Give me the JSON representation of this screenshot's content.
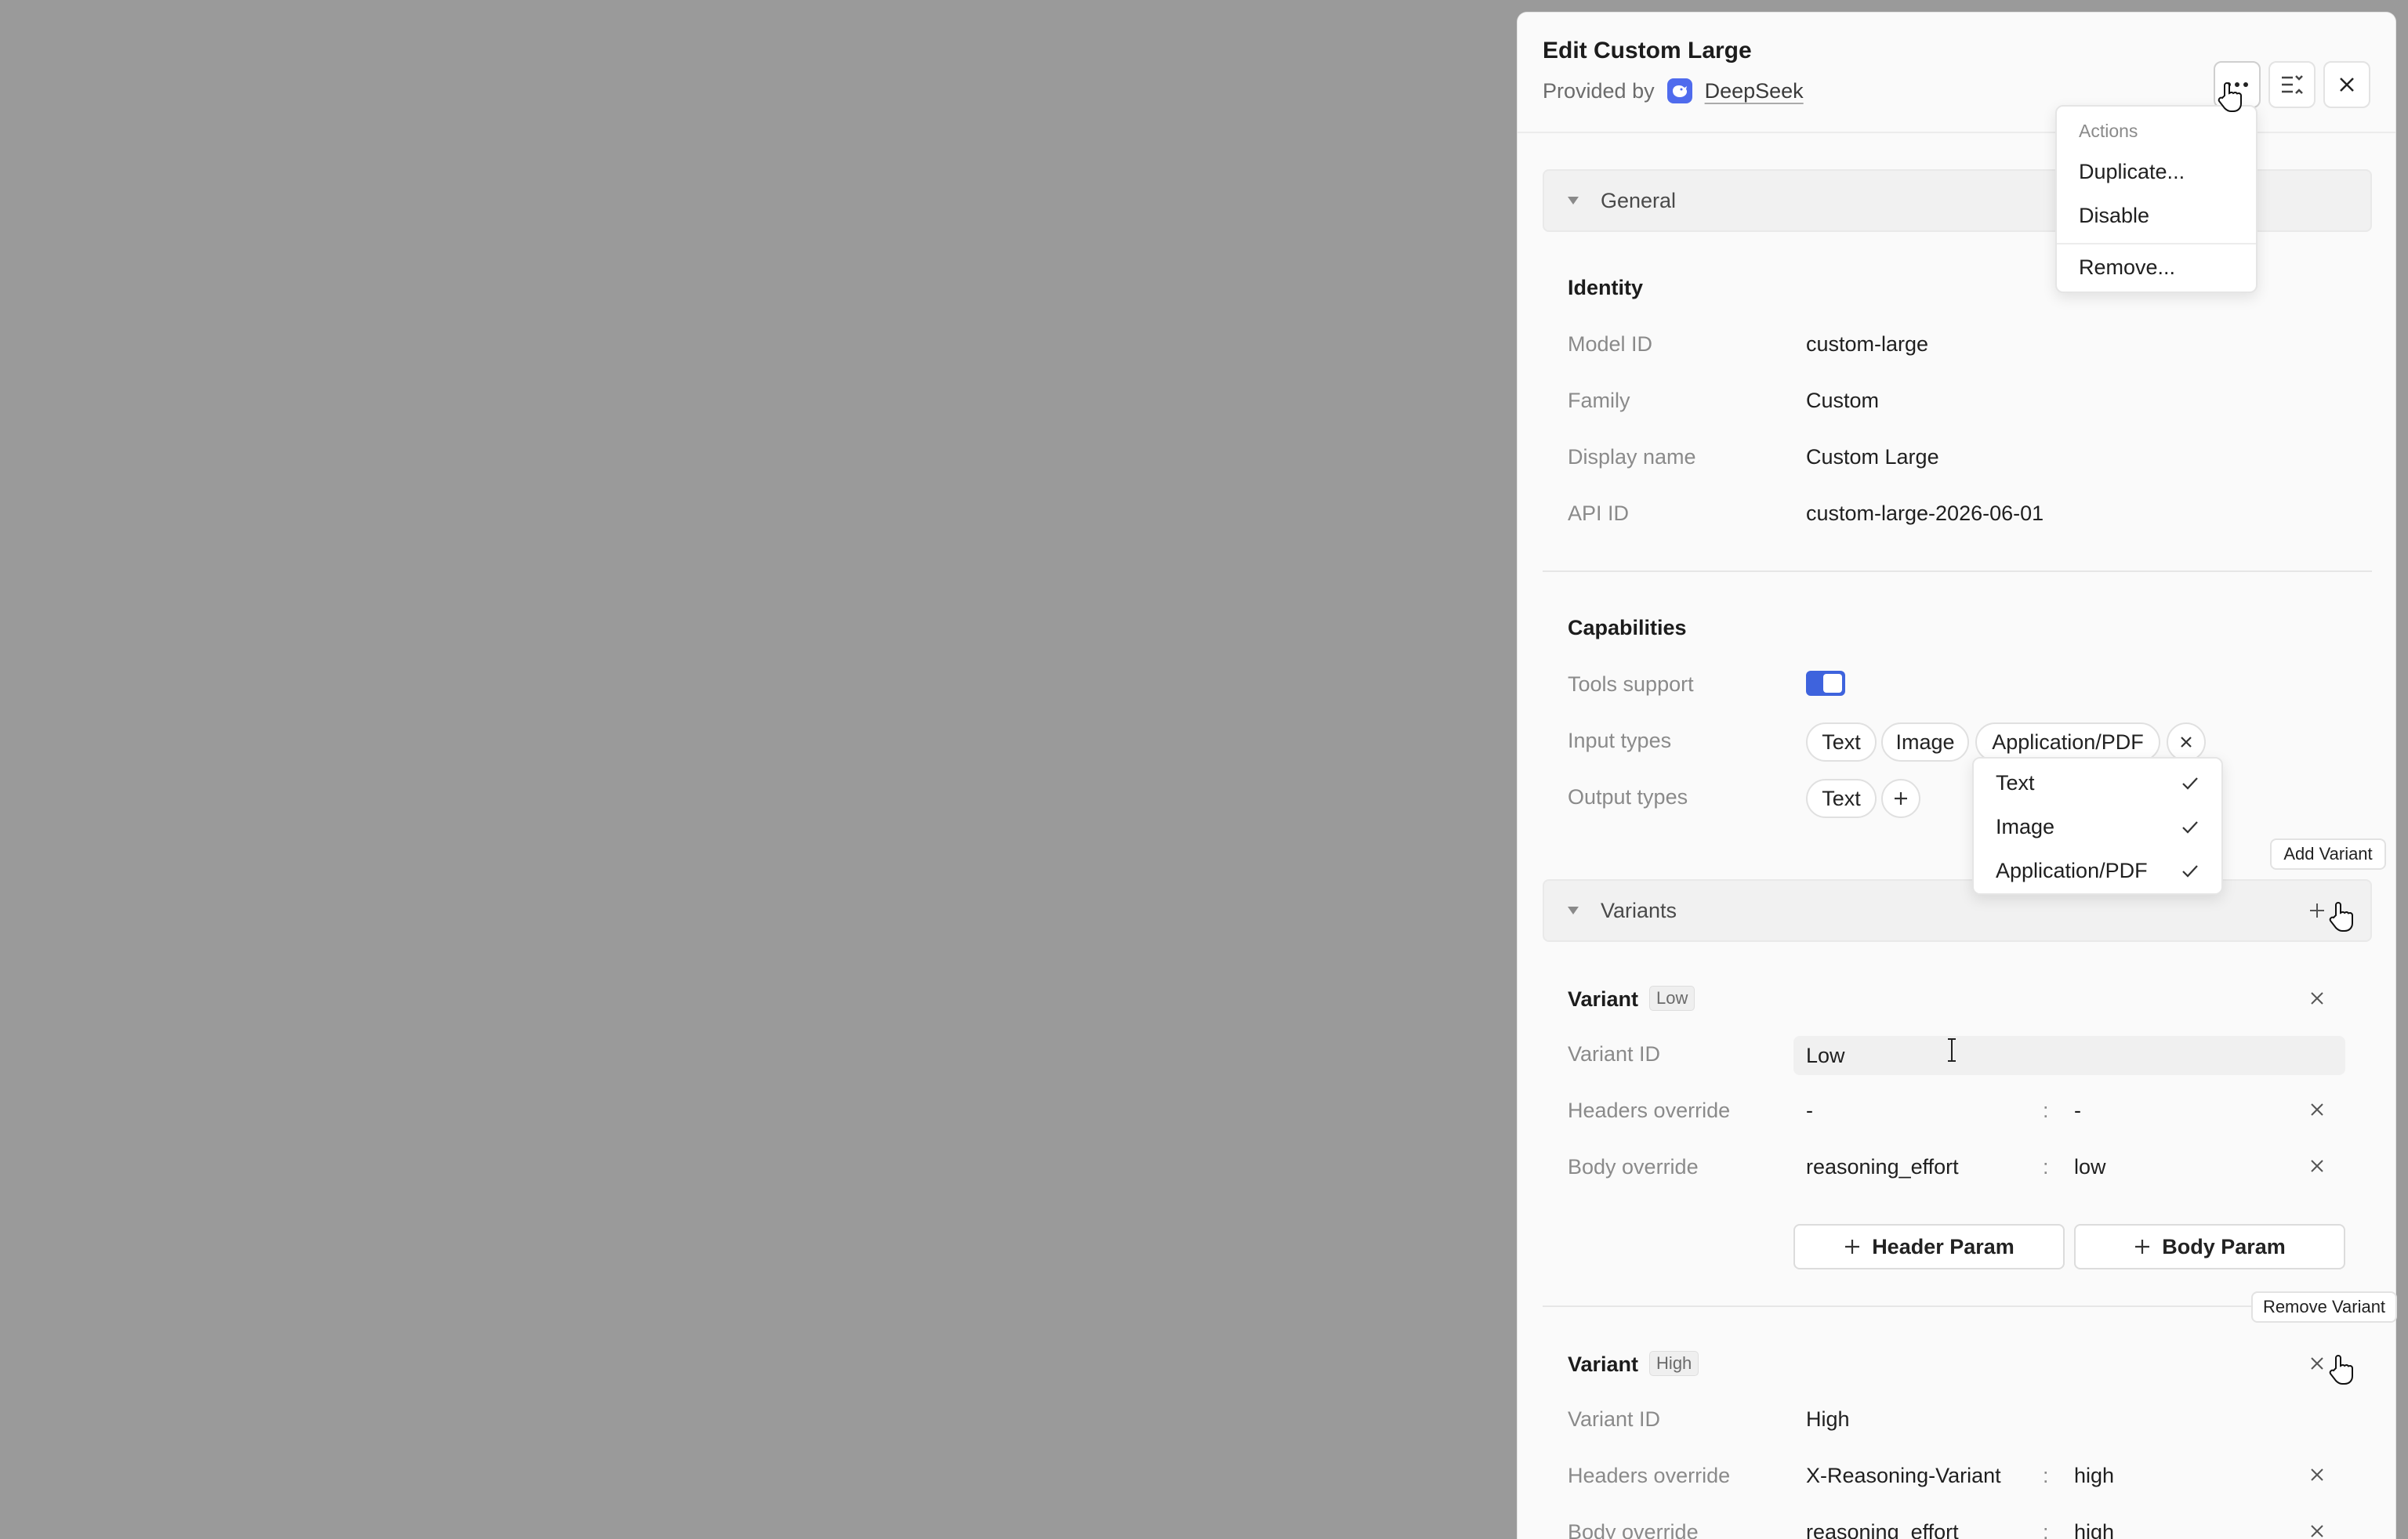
{
  "header": {
    "title": "Edit Custom Large",
    "provided_by_label": "Provided by",
    "provider_name": "DeepSeek"
  },
  "actions_menu": {
    "header": "Actions",
    "items": [
      "Duplicate...",
      "Disable",
      "Remove..."
    ]
  },
  "general": {
    "section_label": "General",
    "identity_title": "Identity",
    "fields": [
      {
        "label": "Model ID",
        "value": "custom-large"
      },
      {
        "label": "Family",
        "value": "Custom"
      },
      {
        "label": "Display name",
        "value": "Custom Large"
      },
      {
        "label": "API ID",
        "value": "custom-large-2026-06-01"
      }
    ],
    "capabilities_title": "Capabilities",
    "tools_support_label": "Tools support",
    "tools_support_on": true,
    "input_types_label": "Input types",
    "input_types": [
      "Text",
      "Image",
      "Application/PDF"
    ],
    "output_types_label": "Output types",
    "output_types": [
      "Text"
    ]
  },
  "input_type_dropdown": {
    "options": [
      "Text",
      "Image",
      "Application/PDF"
    ]
  },
  "variants": {
    "section_label": "Variants",
    "add_tooltip": "Add Variant",
    "remove_tooltip": "Remove Variant",
    "variant_label": "Variant",
    "variant_id_label": "Variant ID",
    "headers_override_label": "Headers override",
    "body_override_label": "Body override",
    "separator": ":",
    "header_param_label": "Header Param",
    "body_param_label": "Body Param",
    "items": [
      {
        "badge": "Low",
        "variant_id": "Low",
        "header_key": "-",
        "header_value": "-",
        "body_key": "reasoning_effort",
        "body_value": "low"
      },
      {
        "badge": "High",
        "variant_id": "High",
        "header_key": "X-Reasoning-Variant",
        "header_value": "high",
        "body_key": "reasoning_effort",
        "body_value": "high"
      }
    ]
  },
  "colors": {
    "accent": "#3e63dd",
    "backdrop": "#9a9a9a",
    "panel": "#fafafa"
  }
}
